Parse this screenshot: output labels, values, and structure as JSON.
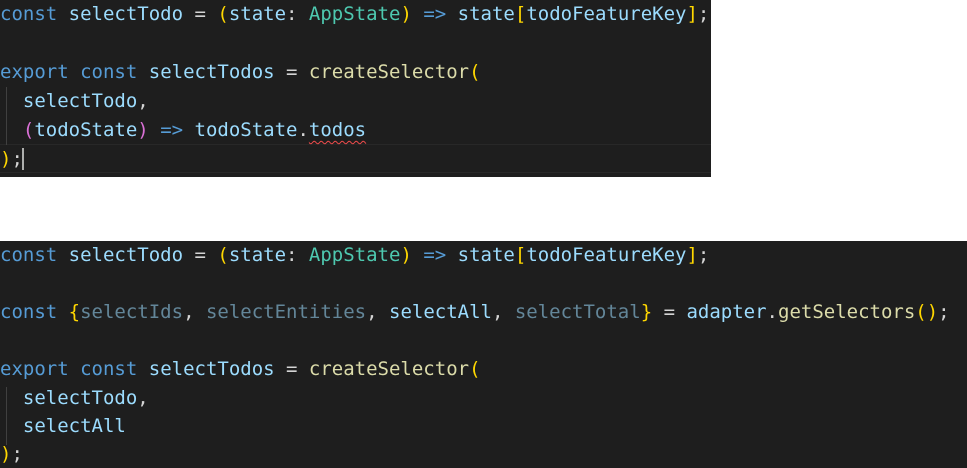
{
  "top": {
    "line1": {
      "kw_const": "const",
      "name": "selectTodo",
      "eq": " = ",
      "paren_open": "(",
      "param": "state",
      "colon": ": ",
      "type": "AppState",
      "paren_close": ")",
      "arrow": " => ",
      "state": "state",
      "br_open": "[",
      "key": "todoFeatureKey",
      "br_close": "]",
      "semi": ";"
    },
    "line3": {
      "kw_export": "export",
      "kw_const": "const",
      "name": "selectTodos",
      "eq": " = ",
      "fn": "createSelector",
      "paren_open": "("
    },
    "line4": {
      "arg": "selectTodo",
      "comma": ","
    },
    "line5": {
      "paren_open": "(",
      "param": "todoState",
      "paren_close": ")",
      "arrow": " => ",
      "obj": "todoState",
      "dot": ".",
      "prop": "todos"
    },
    "line6": {
      "paren_close": ")",
      "semi": ";"
    }
  },
  "bottom": {
    "line1": {
      "kw_const": "const",
      "name": "selectTodo",
      "eq": " = ",
      "paren_open": "(",
      "param": "state",
      "colon": ": ",
      "type": "AppState",
      "paren_close": ")",
      "arrow": " => ",
      "state": "state",
      "br_open": "[",
      "key": "todoFeatureKey",
      "br_close": "]",
      "semi": ";"
    },
    "line3": {
      "kw_const": "const",
      "brace_open": "{",
      "id1": "selectIds",
      "sep1": ", ",
      "id2": "selectEntities",
      "sep2": ", ",
      "id3": "selectAll",
      "sep3": ", ",
      "id4": "selectTotal",
      "brace_close": "}",
      "eq": " = ",
      "obj": "adapter",
      "dot": ".",
      "fn": "getSelectors",
      "call": "()",
      "semi": ";"
    },
    "line5": {
      "kw_export": "export",
      "kw_const": "const",
      "name": "selectTodos",
      "eq": " = ",
      "fn": "createSelector",
      "paren_open": "("
    },
    "line6": {
      "arg": "selectTodo",
      "comma": ","
    },
    "line7": {
      "arg": "selectAll"
    },
    "line8": {
      "paren_close": ")",
      "semi": ";"
    }
  },
  "colors": {
    "background": "#1e1e1e",
    "keyword": "#569cd6",
    "variable": "#9cdcfe",
    "function": "#dcdcaa",
    "type": "#4ec9b0",
    "bracket_level1": "#ffd700",
    "bracket_level2": "#da70d6",
    "bracket_level3": "#179fff",
    "operator": "#d4d4d4",
    "error_squiggle": "#f14c4c"
  }
}
